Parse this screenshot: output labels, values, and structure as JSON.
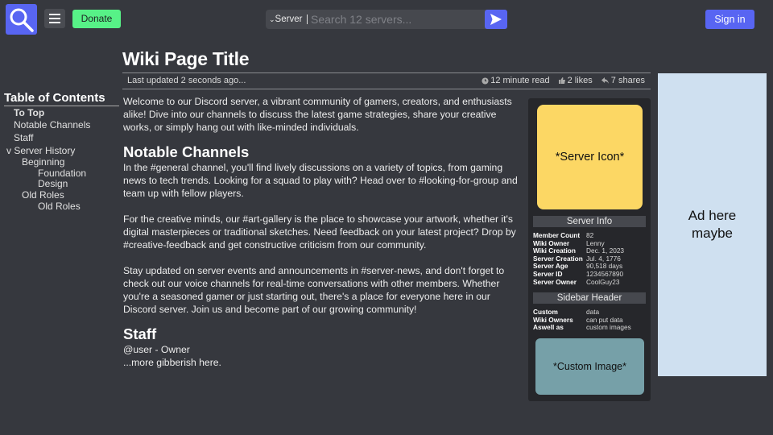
{
  "header": {
    "donate_label": "Donate",
    "search_scope": "Server",
    "search_placeholder": "Search 12 servers...",
    "signin_label": "Sign in",
    "icons": [
      "search-logo-icon",
      "hamburger-menu-icon",
      "chevron-down-icon",
      "send-icon"
    ]
  },
  "page": {
    "title": "Wiki Page Title",
    "last_updated": "Last updated 2 seconds ago...",
    "read_time": "12 minute read",
    "likes": "2 likes",
    "shares": "7 shares"
  },
  "toc": {
    "title": "Table of Contents",
    "items": [
      {
        "label": "To Top"
      },
      {
        "label": "Notable Channels"
      },
      {
        "label": "Staff"
      },
      {
        "label": "v Server History"
      },
      {
        "label": "Beginning"
      },
      {
        "label": "Foundation"
      },
      {
        "label": "Design"
      },
      {
        "label": "Old Roles"
      },
      {
        "label": "Old Roles"
      }
    ]
  },
  "content": {
    "intro": "Welcome to our Discord server, a vibrant community of gamers, creators, and enthusiasts alike! Dive into our channels to discuss the latest game strategies, share your creative works, or simply hang out with like-minded individuals.",
    "section1_title": "Notable Channels",
    "section1_p1": "In the #general channel, you'll find lively discussions on a variety of topics, from gaming news to tech trends. Looking for a squad to play with? Head over to #looking-for-group and team up with fellow players.",
    "section1_p2": "For the creative minds, our #art-gallery is the place to showcase your artwork, whether it's digital masterpieces or traditional sketches. Need feedback on your latest project? Drop by #creative-feedback and get constructive criticism from our community.",
    "section1_p3": "Stay updated on server events and announcements in #server-news, and don't forget to check out our voice channels for real-time conversations with other members. Whether you're a seasoned gamer or just starting out, there's a place for everyone here in our Discord server. Join us and become part of our growing community!",
    "section2_title": "Staff",
    "staff_line1": "@user - Owner",
    "staff_line2": "...more gibberish here."
  },
  "infobox": {
    "server_icon_label": "*Server Icon*",
    "info_header": "Server Info",
    "info_rows": [
      {
        "key": "Member Count",
        "value": "82"
      },
      {
        "key": "Wiki Owner",
        "value": "Lenny"
      },
      {
        "key": "Wiki Creation",
        "value": "Dec. 1, 2023"
      },
      {
        "key": "Server Creation",
        "value": "Jul. 4, 1776"
      },
      {
        "key": "Server Age",
        "value": "90,518 days"
      },
      {
        "key": "Server ID",
        "value": "1234567890"
      },
      {
        "key": "Server Owner",
        "value": "CoolGuy23"
      }
    ],
    "sidebar_header": "Sidebar Header",
    "sidebar_rows": [
      {
        "key": "Custom",
        "value": "data"
      },
      {
        "key": "Wiki Owners",
        "value": "can put data"
      },
      {
        "key": "Aswell as",
        "value": "custom images"
      }
    ],
    "custom_image_label": "*Custom Image*"
  },
  "ad": {
    "line1": "Ad here",
    "line2": "maybe"
  },
  "colors": {
    "background": "#36383e",
    "accent": "#5865f2",
    "donate": "#57f287",
    "server_icon": "#fcd764",
    "custom_image": "#76a0a8",
    "ad": "#cfe0f0"
  }
}
